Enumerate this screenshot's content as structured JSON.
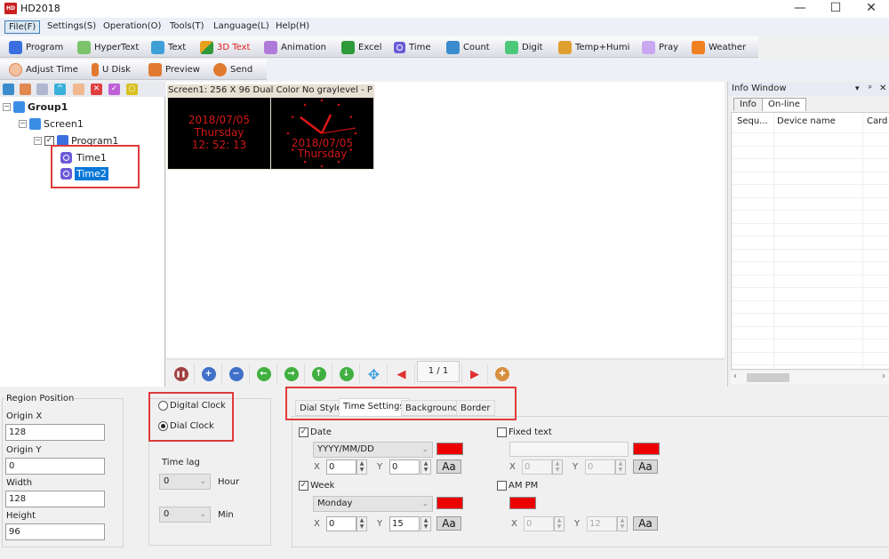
{
  "window": {
    "title": "HD2018",
    "logo_text": "HD",
    "minimize": "—",
    "maximize": "☐",
    "close": "✕"
  },
  "menu": [
    {
      "label": "File(F)"
    },
    {
      "label": "Settings(S)"
    },
    {
      "label": "Operation(O)"
    },
    {
      "label": "Tools(T)"
    },
    {
      "label": "Language(L)"
    },
    {
      "label": "Help(H)"
    }
  ],
  "toolbar1": [
    {
      "label": "Program",
      "icon": "program-icon",
      "color": "#3b6fe0"
    },
    {
      "label": "HyperText",
      "icon": "hypertext-icon",
      "color": "#7cc36b"
    },
    {
      "label": "Text",
      "icon": "text-icon",
      "color": "#3fa0d8"
    },
    {
      "label": "3D Text",
      "icon": "3d-text-icon",
      "color": "#e8a020",
      "text_color": "#e02020"
    },
    {
      "label": "Animation",
      "icon": "animation-icon",
      "color": "#b07ad8"
    },
    {
      "label": "Excel",
      "icon": "excel-icon",
      "color": "#2e9a3a"
    },
    {
      "label": "Time",
      "icon": "time-icon",
      "color": "#6b5bd6"
    },
    {
      "label": "Count",
      "icon": "count-icon",
      "color": "#3a8ccc"
    },
    {
      "label": "Digit",
      "icon": "digit-icon",
      "color": "#4cc87a"
    },
    {
      "label": "Temp+Humi",
      "icon": "temp-humi-icon",
      "color": "#e0a030"
    },
    {
      "label": "Pray",
      "icon": "pray-icon",
      "color": "#a078d8"
    },
    {
      "label": "Weather",
      "icon": "weather-icon",
      "color": "#f08020"
    }
  ],
  "toolbar2": [
    {
      "label": "Adjust Time",
      "icon": "adjust-time-icon",
      "color": "#e08850"
    },
    {
      "label": "U Disk",
      "icon": "u-disk-icon",
      "color": "#e07a30"
    },
    {
      "label": "Preview",
      "icon": "preview-icon",
      "color": "#e07a30"
    },
    {
      "label": "Send",
      "icon": "send-icon",
      "color": "#e07a30"
    }
  ],
  "tree_toolbar": [
    {
      "icon": "add-screen-icon",
      "color": "#3a8ccc"
    },
    {
      "icon": "copy-icon",
      "color": "#e08850"
    },
    {
      "icon": "paste-icon",
      "color": "#b0b8d0"
    },
    {
      "icon": "move-up-icon",
      "color": "#3ab0d8"
    },
    {
      "icon": "move-down-icon",
      "color": "#f0b890"
    },
    {
      "icon": "delete-icon",
      "color": "#e04040"
    },
    {
      "icon": "check-icon",
      "color": "#c060d8"
    },
    {
      "icon": "search-icon",
      "color": "#d8c020"
    }
  ],
  "tree": {
    "group": "Group1",
    "screen": "Screen1",
    "program": "Program1",
    "items": [
      {
        "label": "Time1"
      },
      {
        "label": "Time2",
        "selected": true
      }
    ]
  },
  "canvas": {
    "caption": "Screen1: 256 X 96  Dual Color No graylevel - P",
    "digital_clock": {
      "date": "2018/07/05",
      "week": "Thursday",
      "time": "12: 52: 13"
    },
    "dial_clock": {
      "date": "2018/07/05",
      "week": "Thursday"
    },
    "page_indicator": "1 / 1"
  },
  "nav_buttons": [
    {
      "icon": "pause-icon",
      "color": "#a04040",
      "glyph": "❚❚"
    },
    {
      "icon": "zoom-in-icon",
      "color": "#4070c8",
      "glyph": "+"
    },
    {
      "icon": "zoom-out-icon",
      "color": "#4070c8",
      "glyph": "−"
    },
    {
      "icon": "arrow-left-icon",
      "color": "#40b040",
      "glyph": "←"
    },
    {
      "icon": "arrow-right-icon",
      "color": "#40b040",
      "glyph": "→"
    },
    {
      "icon": "arrow-up-icon",
      "color": "#40b040",
      "glyph": "↑"
    },
    {
      "icon": "arrow-down-icon",
      "color": "#40b040",
      "glyph": "↓"
    },
    {
      "icon": "move-icon",
      "color": "#40a0e0",
      "glyph": "✥"
    },
    {
      "icon": "prev-page-icon",
      "color": "#e03030",
      "glyph": "◀"
    }
  ],
  "info_window": {
    "title": "Info Window",
    "tabs": [
      "Info",
      "On-line"
    ],
    "columns": [
      "Sequ...",
      "Device name",
      "Card"
    ]
  },
  "region_position": {
    "title": "Region Position",
    "origin_x_label": "Origin X",
    "origin_x": "128",
    "origin_y_label": "Origin Y",
    "origin_y": "0",
    "width_label": "Width",
    "width": "128",
    "height_label": "Height",
    "height": "96"
  },
  "clock_type": {
    "digital_label": "Digital Clock",
    "dial_label": "Dial Clock",
    "selected": "Dial Clock",
    "time_lag_label": "Time lag",
    "hour_value": "0",
    "hour_label": "Hour",
    "min_value": "0",
    "min_label": "Min"
  },
  "settings_tabs": [
    "Dial Style",
    "Time Settings",
    "Background",
    "Border"
  ],
  "time_settings": {
    "date": {
      "label": "Date",
      "checked": true,
      "format": "YYYY/MM/DD",
      "x": "0",
      "y": "0",
      "color": "#ee0000"
    },
    "week": {
      "label": "Week",
      "checked": true,
      "format": "Monday",
      "x": "0",
      "y": "15",
      "color": "#ee0000"
    },
    "fixed_text": {
      "label": "Fixed text",
      "checked": false,
      "value": "",
      "x": "0",
      "y": "0",
      "color": "#ee0000"
    },
    "am_pm": {
      "label": "AM PM",
      "checked": false,
      "x": "0",
      "y": "12",
      "color": "#ee0000"
    },
    "x_label": "X",
    "y_label": "Y",
    "font_button": "Aa"
  }
}
